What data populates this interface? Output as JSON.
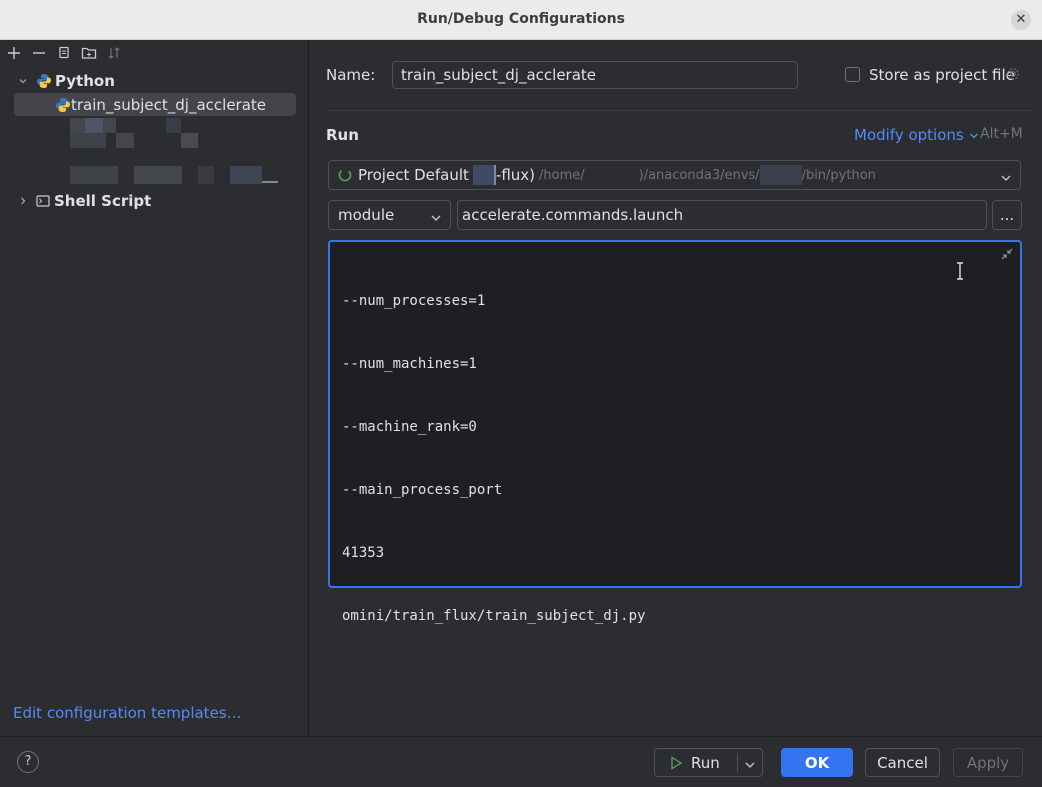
{
  "window": {
    "title": "Run/Debug Configurations",
    "close_glyph": "✕"
  },
  "toolbar": {
    "icons": [
      "add-icon",
      "remove-icon",
      "copy-icon",
      "folder-icon",
      "sort-icon"
    ]
  },
  "tree": {
    "python_group": "Python",
    "selected_config": "train_subject_dj_acclerate",
    "shell_group": "Shell Script"
  },
  "left_footer": {
    "edit_templates": "Edit configuration templates…"
  },
  "form": {
    "name_label": "Name:",
    "name_value": "train_subject_dj_acclerate",
    "store_label": "Store as project file",
    "run_section": "Run",
    "modify_options": "Modify options",
    "modify_shortcut": "Alt+M",
    "interpreter": {
      "label": "Project Default",
      "env_suffix": "-flux)",
      "path_1": "/home/",
      "path_2": ")/anaconda3/envs/",
      "path_3": "/bin/python"
    },
    "run_type": "module",
    "module_name": "accelerate.commands.launch",
    "ellipsis": "...",
    "parameters": [
      "--num_processes=1",
      "--num_machines=1",
      "--machine_rank=0",
      "--main_process_port",
      "41353",
      "omini/train_flux/train_subject_dj.py"
    ]
  },
  "footer": {
    "help": "?",
    "run": "Run",
    "ok": "OK",
    "cancel": "Cancel",
    "apply": "Apply"
  },
  "colors": {
    "accent": "#3574f0",
    "link": "#548af7",
    "background": "#2b2d30"
  }
}
